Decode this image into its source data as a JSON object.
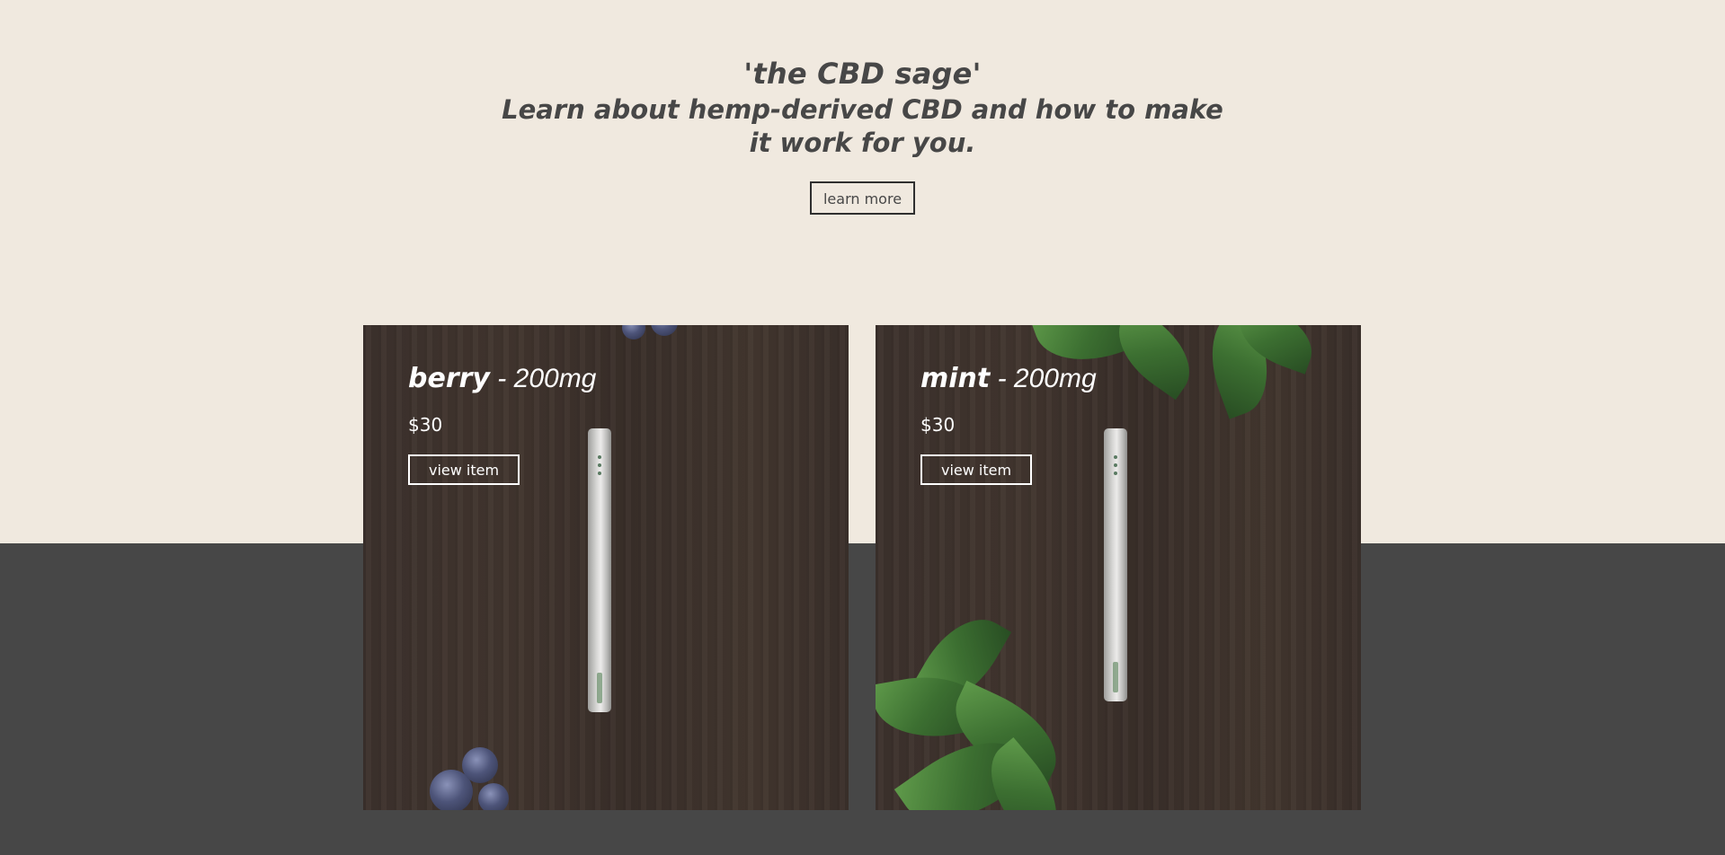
{
  "hero": {
    "kicker": "'the CBD sage'",
    "headline": "Learn about hemp-derived CBD and how to make it work for you.",
    "cta_label": "learn more"
  },
  "products": [
    {
      "flavor": "berry",
      "separator": " - ",
      "dose": "200mg",
      "price": "$30",
      "cta_label": "view item"
    },
    {
      "flavor": "mint",
      "separator": " - ",
      "dose": "200mg",
      "price": "$30",
      "cta_label": "view item"
    }
  ],
  "colors": {
    "cream_background": "#f0e9df",
    "charcoal_background": "#474747",
    "heading_text": "#474747",
    "card_text": "#ffffff",
    "wood": "#3d322d"
  }
}
